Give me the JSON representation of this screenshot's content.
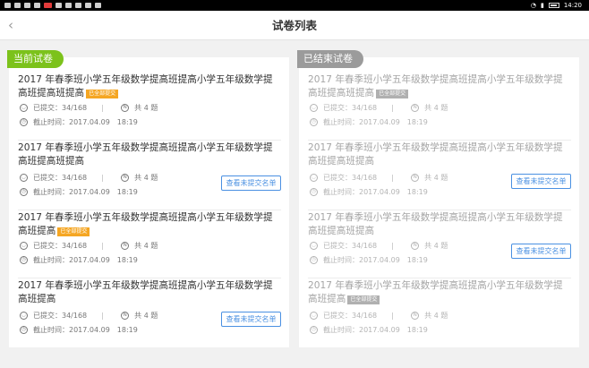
{
  "status_bar": {
    "time": "14:20"
  },
  "navbar": {
    "title": "试卷列表"
  },
  "panels": {
    "current": {
      "label": "当前试卷",
      "items": [
        {
          "title": "2017 年春季班小学五年级数学提高班提高小学五年级数学提高班提高班提高",
          "badge": "已全部提交",
          "submitted": "已提交：34/168",
          "questions": "共 4 题",
          "deadline": "截止时间：2017.04.09　18:19",
          "button": ""
        },
        {
          "title": "2017 年春季班小学五年级数学提高班提高小学五年级数学提高班提高班提高",
          "badge": "",
          "submitted": "已提交：34/168",
          "questions": "共 4 题",
          "deadline": "截止时间：2017.04.09　18:19",
          "button": "查看未提交名单"
        },
        {
          "title": "2017 年春季班小学五年级数学提高班提高小学五年级数学提高班提高",
          "badge": "已全部提交",
          "submitted": "已提交：34/168",
          "questions": "共 4 题",
          "deadline": "截止时间：2017.04.09　18:19",
          "button": ""
        },
        {
          "title": "2017 年春季班小学五年级数学提高班提高小学五年级数学提高班提高",
          "badge": "",
          "submitted": "已提交：34/168",
          "questions": "共 4 题",
          "deadline": "截止时间：2017.04.09　18:19",
          "button": "查看未提交名单"
        }
      ]
    },
    "ended": {
      "label": "已结束试卷",
      "items": [
        {
          "title": "2017 年春季班小学五年级数学提高班提高小学五年级数学提高班提高班提高",
          "badge": "已全部提交",
          "submitted": "已提交：34/168",
          "questions": "共 4 题",
          "deadline": "截止时间：2017.04.09　18:19",
          "button": ""
        },
        {
          "title": "2017 年春季班小学五年级数学提高班提高小学五年级数学提高班提高班提高",
          "badge": "",
          "submitted": "已提交：34/168",
          "questions": "共 4 题",
          "deadline": "截止时间：2017.04.09　18:19",
          "button": "查看未提交名单"
        },
        {
          "title": "2017 年春季班小学五年级数学提高班提高小学五年级数学提高班提高班提高",
          "badge": "",
          "submitted": "已提交：34/168",
          "questions": "共 4 题",
          "deadline": "截止时间：2017.04.09　18:19",
          "button": "查看未提交名单"
        },
        {
          "title": "2017 年春季班小学五年级数学提高班提高小学五年级数学提高班提高",
          "badge": "已全部提交",
          "submitted": "已提交：34/168",
          "questions": "共 4 题",
          "deadline": "截止时间：2017.04.09　18:19",
          "button": ""
        }
      ]
    }
  },
  "icons": {
    "submitted": "person-circle-icon",
    "questions": "n-circle-icon",
    "deadline": "clock-icon",
    "back": "chevron-left-icon"
  },
  "colors": {
    "accent_green": "#7cc21b",
    "badge_orange": "#f5a623",
    "link_blue": "#4a90e2",
    "ended_gray": "#9b9b9b"
  }
}
